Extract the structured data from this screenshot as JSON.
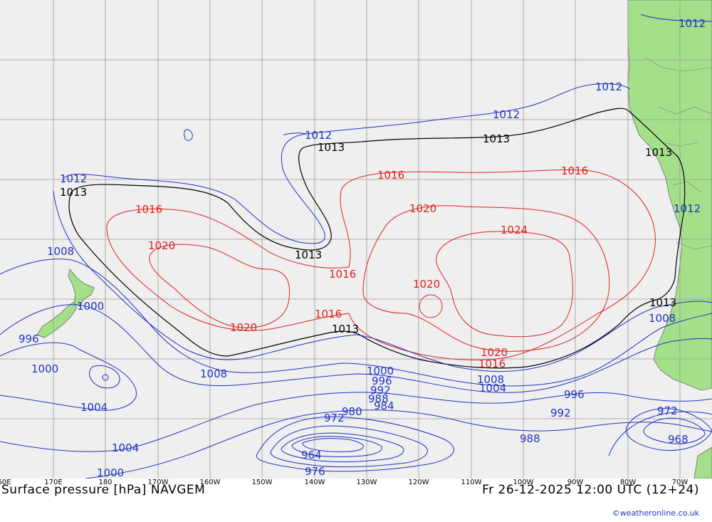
{
  "title": "Surface pressure [hPa] NAVGEM",
  "valid_time": "Fr 26-12-2025 12:00 UTC (12+24)",
  "credit": "©weatheronline.co.uk",
  "colors": {
    "ocean": "#efefef",
    "land": "#a4e08a",
    "grid": "#9a9a9a",
    "low": "#1f33c2",
    "high": "#e02020",
    "mean": "#000000"
  },
  "lon_labels": [
    "60E",
    "170E",
    "180",
    "170W",
    "160W",
    "150W",
    "140W",
    "130W",
    "120W",
    "110W",
    "100W",
    "90W",
    "80W",
    "70W"
  ],
  "isobar_labels": {
    "l1012a": "1012",
    "l1012b": "1012",
    "l1012c": "1012",
    "l1012d": "1012",
    "l1012e": "1012",
    "l1012f": "1012",
    "l1013a": "1013",
    "l1013b": "1013",
    "l1013c": "1013",
    "l1013d": "1013",
    "l1013e": "1013",
    "l1013f": "1013",
    "l1016a": "1016",
    "l1016b": "1016",
    "l1016c": "1016",
    "l1016d": "1016",
    "l1016e": "1016",
    "l1016f": "1016",
    "l1020a": "1020",
    "l1020b": "1020",
    "l1020c": "1020",
    "l1020d": "1020",
    "l1020e": "1020",
    "l1024": "1024",
    "l1008a": "1008",
    "l1008b": "1008",
    "l1008c": "1008",
    "l1008d": "1008",
    "l1004a": "1004",
    "l1004b": "1004",
    "l1004c": "1004",
    "l1000a": "1000",
    "l1000b": "1000",
    "l1000c": "1000",
    "l1000d": "1000",
    "l996a": "996",
    "l996b": "996",
    "l996c": "996",
    "l992a": "992",
    "l992b": "992",
    "l988a": "988",
    "l988b": "988",
    "l984": "984",
    "l980": "980",
    "l976": "976",
    "l972a": "972",
    "l972b": "972",
    "l968": "968",
    "l964": "964"
  }
}
